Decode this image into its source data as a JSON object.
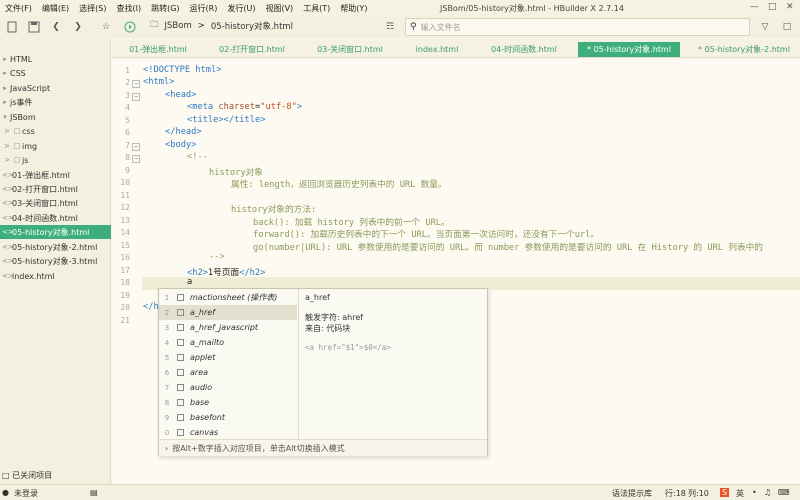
{
  "menu": [
    "文件(F)",
    "编辑(E)",
    "选择(S)",
    "查找(I)",
    "跳转(G)",
    "运行(R)",
    "发行(U)",
    "视图(V)",
    "工具(T)",
    "帮助(Y)"
  ],
  "window": {
    "title": "JSBom/05-history对象.html - HBuilder X 2.7.14"
  },
  "toolbar": {
    "breadcrumb": [
      "JSBom",
      "05-history对象.html"
    ],
    "search_placeholder": "输入文件名"
  },
  "sidebar": {
    "items": [
      {
        "label": "HTML",
        "icon": "folder-icon"
      },
      {
        "label": "CSS",
        "icon": "folder-icon"
      },
      {
        "label": "JavaScript",
        "icon": "folder-icon"
      },
      {
        "label": "js事件",
        "icon": "folder-icon"
      },
      {
        "label": "JSBom",
        "icon": "folder-icon"
      },
      {
        "label": "css",
        "icon": "folder-icon"
      },
      {
        "label": "img",
        "icon": "folder-icon"
      },
      {
        "label": "js",
        "icon": "folder-icon"
      },
      {
        "label": "01-弹出框.html",
        "icon": "file-icon"
      },
      {
        "label": "02-打开窗口.html",
        "icon": "file-icon"
      },
      {
        "label": "03-关闭窗口.html",
        "icon": "file-icon"
      },
      {
        "label": "04-时间函数.html",
        "icon": "file-icon"
      },
      {
        "label": "05-history对象.html",
        "icon": "file-icon",
        "active": true
      },
      {
        "label": "05-history对象-2.html",
        "icon": "file-icon"
      },
      {
        "label": "05-history对象-3.html",
        "icon": "file-icon"
      },
      {
        "label": "index.html",
        "icon": "file-icon"
      }
    ],
    "footer": "已关闭项目"
  },
  "tabs": [
    {
      "label": "01-弹出框.html"
    },
    {
      "label": "02-打开窗口.html"
    },
    {
      "label": "03-关闭窗口.html"
    },
    {
      "label": "index.html"
    },
    {
      "label": "04-时间函数.html"
    },
    {
      "label": "* 05-history对象.html",
      "active": true
    },
    {
      "label": "* 05-history对象-2.html"
    }
  ],
  "editor": {
    "line_numbers": [
      "1",
      "2",
      "3",
      "4",
      "5",
      "6",
      "7",
      "8",
      "9",
      "10",
      "11",
      "12",
      "13",
      "14",
      "15",
      "16",
      "17",
      "18",
      "19",
      "20",
      "21"
    ],
    "lines": {
      "l1": "<!DOCTYPE html>",
      "l2": "<html>",
      "l3": "<head>",
      "l4a": "<meta ",
      "l4b": "charset",
      "l4c": "=",
      "l4d": "\"utf-8\"",
      "l4e": ">",
      "l5": "<title></title>",
      "l6": "</head>",
      "l7": "<body>",
      "l8": "<!--",
      "l9": "history对象",
      "l10": "属性: length，返回浏览器历史列表中的 URL 数量。",
      "l12": "history对象的方法:",
      "l13": "back(): 加载 history 列表中的前一个 URL。",
      "l14": "forward(): 加载历史列表中的下一个 URL。当页面第一次访问时，还没有下一个url。",
      "l15": "go(number|URL): URL 参数使用的是要访问的 URL。而 number 参数使用的是要访问的 URL 在 History 的 URL 列表中的",
      "l16": "-->",
      "l17a": "<h2>",
      "l17b": "1号页面",
      "l17c": "</h2>",
      "l18": "a",
      "l20": "</h"
    }
  },
  "autocomplete": {
    "items": [
      {
        "num": "1",
        "label": "mactionsheet (操作表)"
      },
      {
        "num": "2",
        "label": "a_href",
        "selected": true
      },
      {
        "num": "3",
        "label": "a_href_javascript"
      },
      {
        "num": "4",
        "label": "a_mailto"
      },
      {
        "num": "5",
        "label": "applet"
      },
      {
        "num": "6",
        "label": "area"
      },
      {
        "num": "7",
        "label": "audio"
      },
      {
        "num": "8",
        "label": "base"
      },
      {
        "num": "9",
        "label": "basefont"
      },
      {
        "num": "0",
        "label": "canvas"
      }
    ],
    "detail": {
      "title": "a_href",
      "trigger": "触发字符: ahref",
      "source": "来自: 代码块",
      "snippet": "<a href=\"$1\">$0</a>"
    },
    "footer": "按Alt+数字插入对应项目，单击Alt切换插入模式"
  },
  "status": {
    "login": "未登录",
    "grammar": "语法提示库",
    "row": "行:18",
    "col": "列:10",
    "ime": "英"
  },
  "colors": {
    "accent": "#3eaf7c",
    "background": "#fdfbf1",
    "tag": "#2f77c4",
    "comment": "#8a9a5b"
  }
}
